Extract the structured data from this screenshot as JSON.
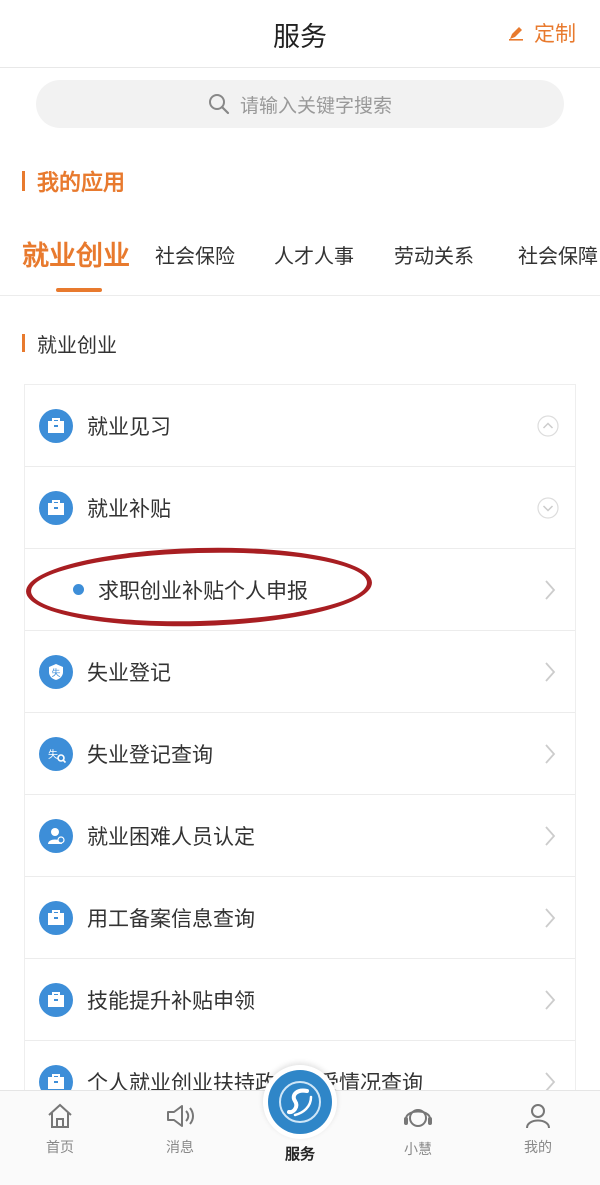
{
  "header": {
    "title": "服务",
    "customize_label": "定制"
  },
  "search": {
    "placeholder": "请输入关键字搜索"
  },
  "my_apps": {
    "title": "我的应用"
  },
  "tabs": [
    {
      "label": "就业创业",
      "active": true
    },
    {
      "label": "社会保险",
      "active": false
    },
    {
      "label": "人才人事",
      "active": false
    },
    {
      "label": "劳动关系",
      "active": false
    },
    {
      "label": "社会保障",
      "active": false
    }
  ],
  "section": {
    "title": "就业创业"
  },
  "items": [
    {
      "label": "就业见习",
      "icon": "briefcase-icon",
      "indicator": "collapse-up"
    },
    {
      "label": "就业补贴",
      "icon": "briefcase-icon",
      "indicator": "expand-down"
    },
    {
      "label": "求职创业补贴个人申报",
      "icon": "bullet-dot",
      "indicator": "chevron-right"
    },
    {
      "label": "失业登记",
      "icon": "unemployment-shield-icon",
      "indicator": "chevron-right"
    },
    {
      "label": "失业登记查询",
      "icon": "unemployment-search-icon",
      "indicator": "chevron-right"
    },
    {
      "label": "就业困难人员认定",
      "icon": "person-icon",
      "indicator": "chevron-right"
    },
    {
      "label": "用工备案信息查询",
      "icon": "briefcase-icon",
      "indicator": "chevron-right"
    },
    {
      "label": "技能提升补贴申领",
      "icon": "briefcase-icon",
      "indicator": "chevron-right"
    },
    {
      "label": "个人就业创业扶持政策享受情况查询",
      "icon": "briefcase-icon",
      "indicator": "chevron-right"
    }
  ],
  "tabbar": [
    {
      "label": "首页",
      "icon": "home-icon"
    },
    {
      "label": "消息",
      "icon": "speaker-icon"
    },
    {
      "label": "服务",
      "icon": "service-logo-icon"
    },
    {
      "label": "小慧",
      "icon": "headset-icon"
    },
    {
      "label": "我的",
      "icon": "user-icon"
    }
  ],
  "colors": {
    "accent": "#e87a2e",
    "blue": "#3d8ed8",
    "highlight": "#a81e22"
  }
}
